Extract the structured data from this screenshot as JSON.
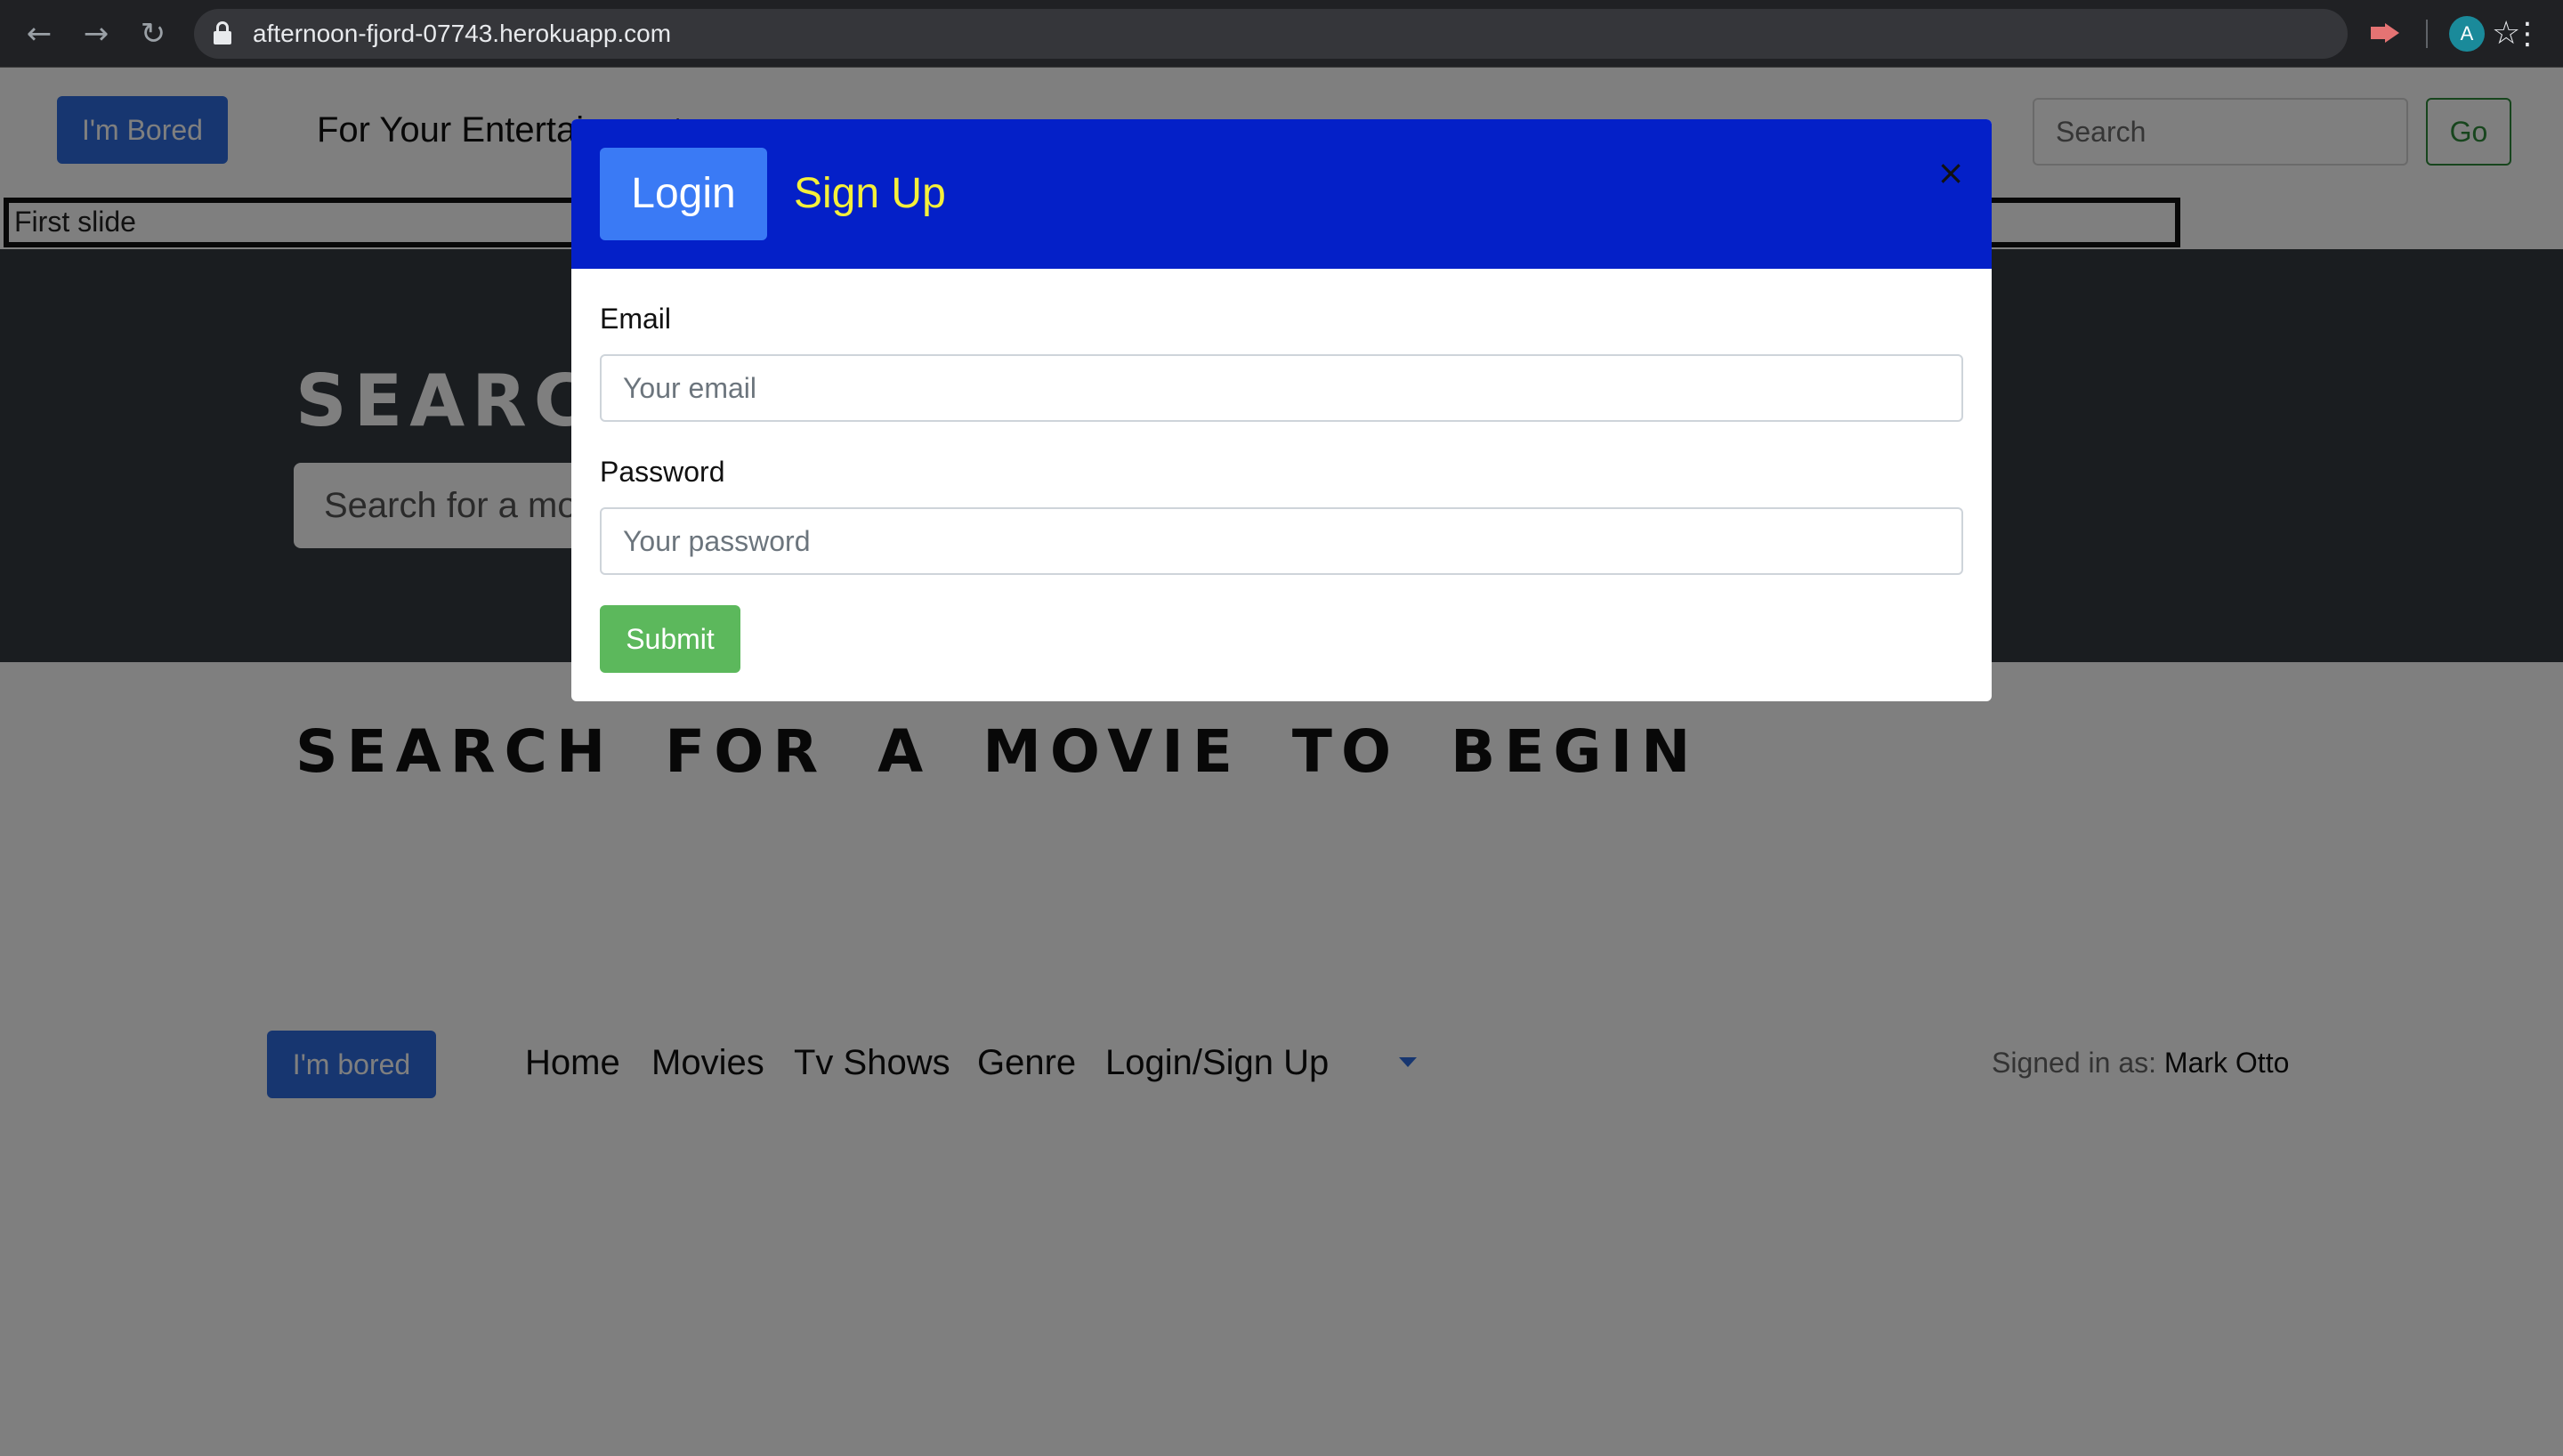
{
  "browser": {
    "url": "afternoon-fjord-07743.herokuapp.com",
    "profile_initial": "A"
  },
  "header": {
    "bored_button": "I'm Bored",
    "brand_text": "For Your Entertainment",
    "search_placeholder": "Search",
    "go_button": "Go"
  },
  "carousel": {
    "image_alt": "First slide"
  },
  "hero": {
    "title": "SEARCH",
    "search_placeholder": "Search for a movie"
  },
  "main": {
    "headline": "SEARCH FOR A MOVIE TO BEGIN"
  },
  "footer_nav": {
    "bored_button": "I'm bored",
    "links": [
      "Home",
      "Movies",
      "Tv Shows",
      "Genre",
      "Login/Sign Up"
    ],
    "signed_in_label": "Signed in as:",
    "signed_in_user": "Mark Otto"
  },
  "modal": {
    "tabs": [
      "Login",
      "Sign Up"
    ],
    "close_glyph": "×",
    "email_label": "Email",
    "email_placeholder": "Your email",
    "password_label": "Password",
    "password_placeholder": "Your password",
    "submit_label": "Submit"
  },
  "colors": {
    "modal_header": "#0420c8",
    "login_tab": "#3a7af5",
    "signup_tab_text": "#f5f03a",
    "submit": "#5cb85c",
    "primary_button": "#2e6de0"
  }
}
